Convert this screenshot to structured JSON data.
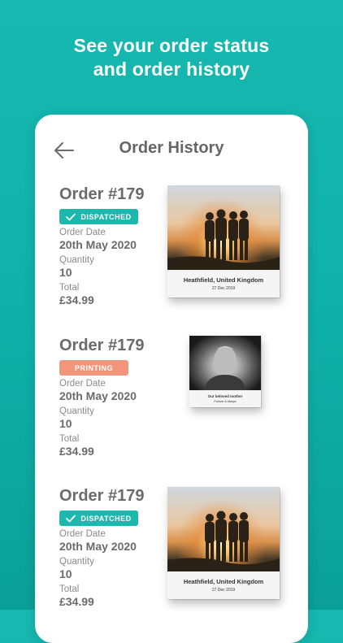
{
  "promo": {
    "line1": "See your order status",
    "line2": "and order history"
  },
  "header": {
    "title": "Order History"
  },
  "labels": {
    "order_date": "Order Date",
    "quantity": "Quantity",
    "total": "Total"
  },
  "orders": [
    {
      "number": "Order #179",
      "status": "DISPATCHED",
      "date": "20th May 2020",
      "quantity": "10",
      "total": "£34.99",
      "book": {
        "title": "Heathfield, United Kingdom",
        "subtitle": "27 Dec 2019"
      }
    },
    {
      "number": "Order #179",
      "status": "PRINTING",
      "date": "20th May 2020",
      "quantity": "10",
      "total": "£34.99",
      "book": {
        "title": "Our beloved mother",
        "subtitle": "Forever & Always"
      }
    },
    {
      "number": "Order #179",
      "status": "DISPATCHED",
      "date": "20th May 2020",
      "quantity": "10",
      "total": "£34.99",
      "book": {
        "title": "Heathfield, United Kingdom",
        "subtitle": "27 Dec 2019"
      }
    }
  ],
  "colors": {
    "background": "#12b2aa",
    "dispatched": "#1cb8ae",
    "printing": "#f3957a"
  }
}
